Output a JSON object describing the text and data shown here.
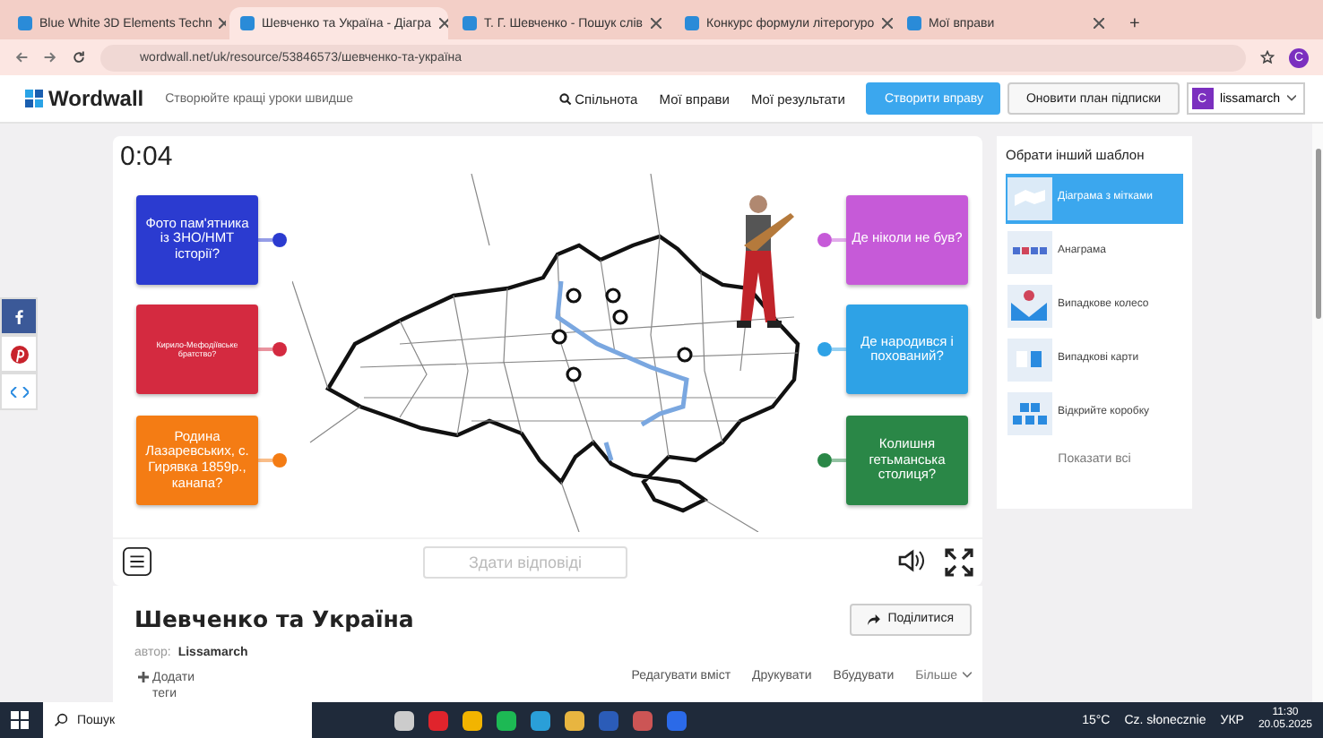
{
  "browser": {
    "tabs": [
      {
        "title": "Blue White 3D Elements Techn",
        "selected": false
      },
      {
        "title": "Шевченко та Україна - Діагра",
        "selected": true
      },
      {
        "title": "Т. Г. Шевченко - Пошук слів",
        "selected": false
      },
      {
        "title": "Конкурс формули літерогуро",
        "selected": false
      },
      {
        "title": "Мої вправи",
        "selected": false
      }
    ],
    "new_tab": "+",
    "url": "wordwall.net/uk/resource/53846573/шевченко-та-україна",
    "profile": "C"
  },
  "site": {
    "logo": "Wordwall",
    "tagline": "Створюйте кращі уроки швидше",
    "nav": [
      "Спільнота",
      "Мої вправи",
      "Мої результати"
    ],
    "create_button": "Створити вправу",
    "upgrade_button": "Оновити план підписки",
    "user": {
      "initial": "C",
      "name": "lissamarch"
    }
  },
  "game": {
    "timer": "0:04",
    "left_labels": [
      {
        "text": "Фото пам'ятника із ЗНО/НМТ історії?",
        "color": "#2b3bd0",
        "small": false
      },
      {
        "text": "Кирило-Мефодіївське братство?",
        "color": "#d42a40",
        "small": true
      },
      {
        "text": "Родина Лазаревських, с. Гирявка 1859р., канапа?",
        "color": "#f47c14",
        "small": false
      }
    ],
    "right_labels": [
      {
        "text": "Де ніколи не був?",
        "color": "#c65ad8",
        "small": false
      },
      {
        "text": "Де народився і похований?",
        "color": "#2ea2e6",
        "small": false
      },
      {
        "text": "Колишня гетьманська столиця?",
        "color": "#2a8747",
        "small": false
      }
    ],
    "submit_button": {
      "label": "Здати відповіді",
      "disabled": true
    }
  },
  "activity": {
    "title": "Шевченко та Україна",
    "author_label": "автор:",
    "author": "Lissamarch",
    "share_button": "Поділитися",
    "add_tags": "Додати теги",
    "actions": [
      "Редагувати вміст",
      "Друкувати",
      "Вбудувати"
    ],
    "more": "Більше"
  },
  "sidebar": {
    "heading": "Обрати інший шаблон",
    "templates": [
      {
        "name": "Діаграма з мітками",
        "selected": true
      },
      {
        "name": "Анаграма",
        "selected": false
      },
      {
        "name": "Випадкове колесо",
        "selected": false
      },
      {
        "name": "Випадкові карти",
        "selected": false
      },
      {
        "name": "Відкрийте коробку",
        "selected": false
      }
    ],
    "show_all": "Показати всі"
  },
  "taskbar": {
    "search": "Пошук",
    "temperature": "15°C",
    "weather": "Cz. słonecznie",
    "language": "УКР",
    "time": "11:30",
    "date": "20.05.2025"
  }
}
